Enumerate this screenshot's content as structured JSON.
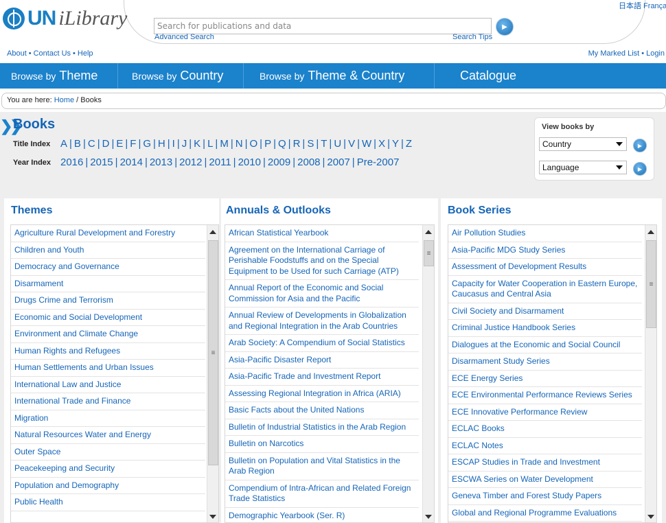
{
  "header": {
    "logo_un": "UN",
    "logo_ilibrary": "iLibrary",
    "search_placeholder": "Search for publications and data",
    "advanced_search": "Advanced Search",
    "search_tips": "Search Tips",
    "languages": "日本語  França",
    "about": "About",
    "contact": "Contact Us",
    "help": "Help",
    "sep": "•",
    "my_marked_list": "My Marked List",
    "login": "Login"
  },
  "nav": {
    "browse_by": "Browse by",
    "theme": "Theme",
    "country": "Country",
    "theme_country": "Theme & Country",
    "catalogue": "Catalogue"
  },
  "breadcrumb": {
    "prefix": "You are here:",
    "home": "Home",
    "slash": "/",
    "current": "Books"
  },
  "books": {
    "title": "Books",
    "title_index_label": "Title Index",
    "year_index_label": "Year Index",
    "letters": [
      "A",
      "B",
      "C",
      "D",
      "E",
      "F",
      "G",
      "H",
      "I",
      "J",
      "K",
      "L",
      "M",
      "N",
      "O",
      "P",
      "Q",
      "R",
      "S",
      "T",
      "U",
      "V",
      "W",
      "X",
      "Y",
      "Z"
    ],
    "years": [
      "2016",
      "2015",
      "2014",
      "2013",
      "2012",
      "2011",
      "2010",
      "2009",
      "2008",
      "2007",
      "Pre-2007"
    ],
    "index_sep": "|"
  },
  "view_books_by": {
    "title": "View books by",
    "country_select": "Country",
    "language_select": "Language"
  },
  "themes": {
    "title": "Themes",
    "items": [
      "Agriculture Rural Development and Forestry",
      "Children and Youth",
      "Democracy and Governance",
      "Disarmament",
      "Drugs Crime and Terrorism",
      "Economic and Social Development",
      "Environment and Climate Change",
      "Human Rights and Refugees",
      "Human Settlements and Urban Issues",
      "International Law and Justice",
      "International Trade and Finance",
      "Migration",
      "Natural Resources Water and Energy",
      "Outer Space",
      "Peacekeeping and Security",
      "Population and Demography",
      "Public Health"
    ]
  },
  "annuals": {
    "title": "Annuals & Outlooks",
    "items": [
      "African Statistical Yearbook",
      "Agreement on the International Carriage of Perishable Foodstuffs and on the Special Equipment to be Used for such Carriage (ATP)",
      "Annual Report of the Economic and Social Commission for Asia and the Pacific",
      "Annual Review of Developments in Globalization and Regional Integration in the Arab Countries",
      "Arab Society: A Compendium of Social Statistics",
      "Asia-Pacific Disaster Report",
      "Asia-Pacific Trade and Investment Report",
      "Assessing Regional Integration in Africa (ARIA)",
      "Basic Facts about the United Nations",
      "Bulletin of Industrial Statistics in the Arab Region",
      "Bulletin on Narcotics",
      "Bulletin on Population and Vital Statistics in the Arab Region",
      "Compendium of Intra-African and Related Foreign Trade Statistics",
      "Demographic Yearbook (Ser. R)"
    ]
  },
  "series": {
    "title": "Book Series",
    "items": [
      "Air Pollution Studies",
      "Asia-Pacific MDG Study Series",
      "Assessment of Development Results",
      "Capacity for Water Cooperation in Eastern Europe, Caucasus and Central Asia",
      "Civil Society and Disarmament",
      "Criminal Justice Handbook Series",
      "Dialogues at the Economic and Social Council",
      "Disarmament Study Series",
      "ECE Energy Series",
      "ECE Environmental Performance Reviews Series",
      "ECE Innovative Performance Review",
      "ECLAC Books",
      "ECLAC Notes",
      "ESCAP Studies in Trade and Investment",
      "ESCWA Series on Water Development",
      "Geneva Timber and Forest Study Papers",
      "Global and Regional Programme Evaluations"
    ]
  },
  "colors": {
    "nav_blue": "#1b82cc",
    "link_blue": "#1565b7",
    "panel_grey": "#eeeeee"
  },
  "icons": {
    "search_go": "arrow-right-circle-icon",
    "chevrons": "double-chevron-icon",
    "scroll_thumb": "grip-lines-icon"
  }
}
